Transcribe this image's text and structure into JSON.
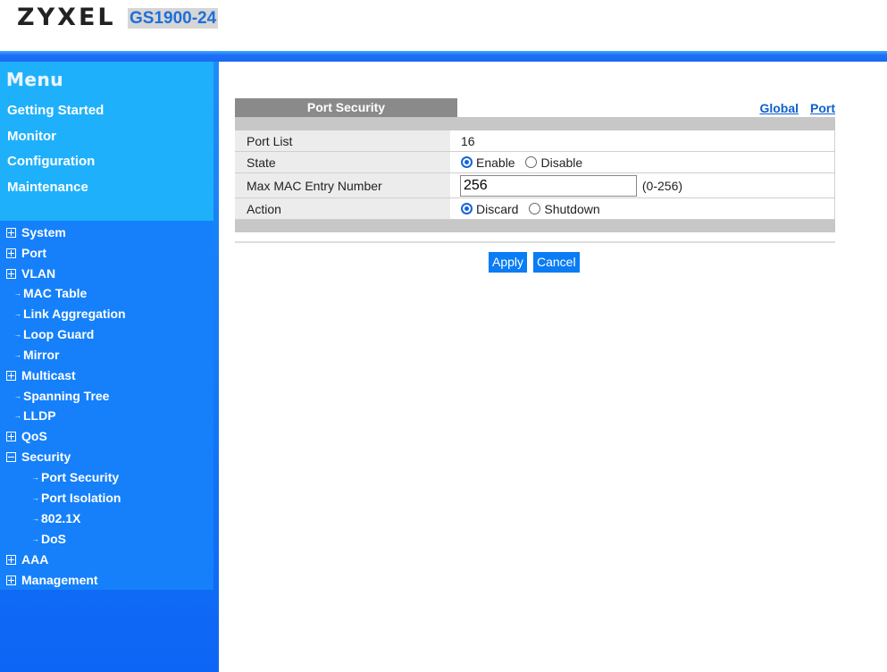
{
  "header": {
    "logo": "ZYXEL",
    "model": "GS1900-24"
  },
  "menu": {
    "title": "Menu",
    "links": [
      "Getting Started",
      "Monitor",
      "Configuration",
      "Maintenance"
    ]
  },
  "tree": {
    "system": "System",
    "port": "Port",
    "vlan": "VLAN",
    "mac_table": "MAC Table",
    "link_aggregation": "Link Aggregation",
    "loop_guard": "Loop Guard",
    "mirror": "Mirror",
    "multicast": "Multicast",
    "spanning_tree": "Spanning Tree",
    "lldp": "LLDP",
    "qos": "QoS",
    "security": "Security",
    "port_security": "Port Security",
    "port_isolation": "Port Isolation",
    "dot1x": "802.1X",
    "dos": "DoS",
    "aaa": "AAA",
    "management": "Management"
  },
  "panel": {
    "title": "Port Security",
    "links": {
      "global": "Global",
      "port": "Port"
    },
    "rows": {
      "port_list": {
        "label": "Port List",
        "value": "16"
      },
      "state": {
        "label": "State",
        "enable": "Enable",
        "disable": "Disable",
        "selected": "Enable"
      },
      "max_mac": {
        "label": "Max MAC Entry Number",
        "value": "256",
        "range": "(0-256)"
      },
      "action": {
        "label": "Action",
        "discard": "Discard",
        "shutdown": "Shutdown",
        "selected": "Discard"
      }
    },
    "buttons": {
      "apply": "Apply",
      "cancel": "Cancel"
    }
  }
}
